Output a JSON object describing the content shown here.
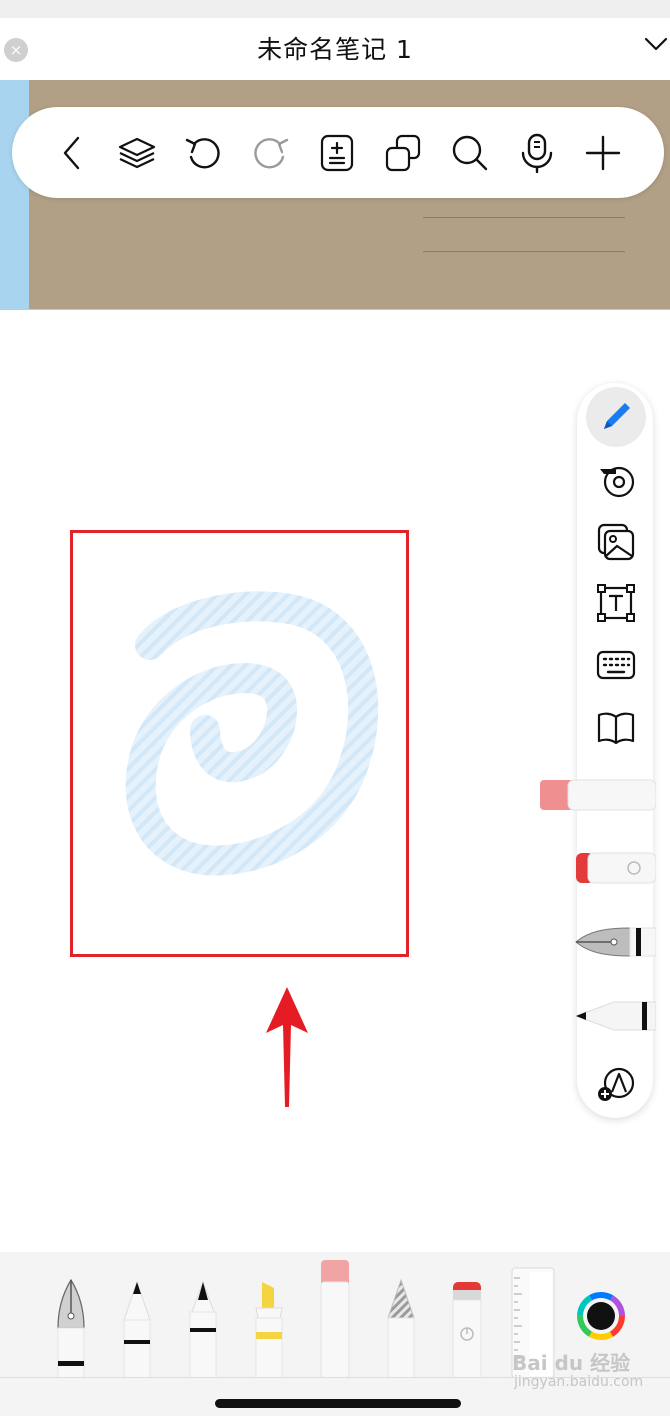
{
  "header": {
    "title": "未命名笔记 1",
    "close_glyph": "×",
    "close_icon": "close-icon",
    "menu_icon": "chevron-down-icon"
  },
  "cover": {
    "background": "#b19f86",
    "spine_color": "#a8d4f0"
  },
  "toolbar": {
    "items": [
      {
        "icon": "back-icon"
      },
      {
        "icon": "layers-icon"
      },
      {
        "icon": "undo-icon"
      },
      {
        "icon": "redo-icon",
        "disabled": true
      },
      {
        "icon": "page-add-icon"
      },
      {
        "icon": "duplicate-icon"
      },
      {
        "icon": "search-icon"
      },
      {
        "icon": "microphone-icon"
      },
      {
        "icon": "plus-icon"
      }
    ]
  },
  "side_panel": {
    "tools": [
      {
        "icon": "pen-icon",
        "active": true,
        "color": "#1a7cf0"
      },
      {
        "icon": "tape-icon"
      },
      {
        "icon": "image-icon"
      },
      {
        "icon": "textbox-icon"
      },
      {
        "icon": "keyboard-icon"
      },
      {
        "icon": "book-icon"
      },
      {
        "icon": "eraser-tool-icon"
      },
      {
        "icon": "smart-eraser-icon"
      },
      {
        "icon": "fountain-pen-icon"
      },
      {
        "icon": "pencil-icon"
      },
      {
        "icon": "add-shape-icon"
      }
    ]
  },
  "canvas": {
    "stroke_color": "#d6eaf8",
    "selection_color": "#e0222a",
    "annotation_arrow_color": "#e61c24"
  },
  "bottom_tools": [
    {
      "icon": "fountain-pen-icon"
    },
    {
      "icon": "ballpoint-pen-icon"
    },
    {
      "icon": "fineliner-icon"
    },
    {
      "icon": "highlighter-icon",
      "color": "#f5d442"
    },
    {
      "icon": "eraser-icon",
      "color": "#f2a3a3"
    },
    {
      "icon": "pencil-icon"
    },
    {
      "icon": "smart-eraser-icon",
      "color": "#e53935"
    },
    {
      "icon": "ruler-icon"
    },
    {
      "icon": "color-picker-icon",
      "color": "#111111"
    }
  ],
  "watermark": {
    "brand": "Bai du 经验",
    "url": "jingyan.baidu.com"
  }
}
